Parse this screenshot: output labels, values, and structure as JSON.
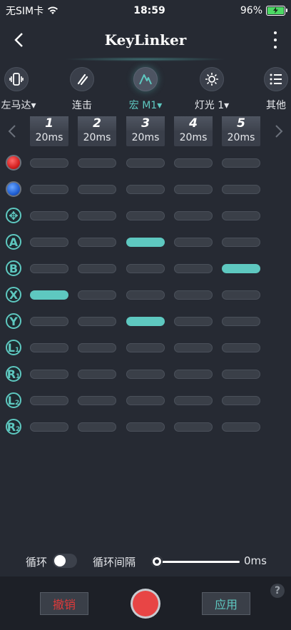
{
  "status": {
    "carrier": "无SIM卡",
    "time": "18:59",
    "battery": "96%"
  },
  "header": {
    "title": "KeyLinker"
  },
  "toolbar": [
    {
      "label": "左马达▾",
      "icon": "vibration-icon"
    },
    {
      "label": "连击",
      "icon": "turbo-icon"
    },
    {
      "label": "宏 M1▾",
      "icon": "macro-icon"
    },
    {
      "label": "灯光 1▾",
      "icon": "light-icon"
    },
    {
      "label": "其他",
      "icon": "list-icon"
    }
  ],
  "steps": [
    {
      "num": "1",
      "dur": "20ms"
    },
    {
      "num": "2",
      "dur": "20ms"
    },
    {
      "num": "3",
      "dur": "20ms"
    },
    {
      "num": "4",
      "dur": "20ms"
    },
    {
      "num": "5",
      "dur": "20ms"
    }
  ],
  "rows": [
    {
      "icon": "red-button-icon",
      "glyph": "",
      "active": []
    },
    {
      "icon": "blue-button-icon",
      "glyph": "",
      "active": []
    },
    {
      "icon": "dpad-icon",
      "glyph": "✥",
      "active": []
    },
    {
      "icon": "a-button-icon",
      "glyph": "A",
      "active": [
        3
      ]
    },
    {
      "icon": "b-button-icon",
      "glyph": "B",
      "active": [
        5
      ]
    },
    {
      "icon": "x-button-icon",
      "glyph": "X",
      "active": [
        1
      ]
    },
    {
      "icon": "y-button-icon",
      "glyph": "Y",
      "active": [
        3
      ]
    },
    {
      "icon": "l1-button-icon",
      "glyph": "L",
      "sub": "1",
      "active": []
    },
    {
      "icon": "r1-button-icon",
      "glyph": "R",
      "sub": "1",
      "active": []
    },
    {
      "icon": "l2-button-icon",
      "glyph": "L",
      "sub": "2",
      "active": []
    },
    {
      "icon": "r2-button-icon",
      "glyph": "R",
      "sub": "2",
      "active": []
    }
  ],
  "loop": {
    "label": "循环",
    "interval_label": "循环间隔",
    "interval_value": "0ms",
    "enabled": false,
    "interval_level": 0
  },
  "bottom": {
    "undo": "撤销",
    "apply": "应用",
    "help": "?"
  },
  "colors": {
    "accent": "#5ec8c0",
    "background": "#262a33",
    "record": "#e84545"
  }
}
